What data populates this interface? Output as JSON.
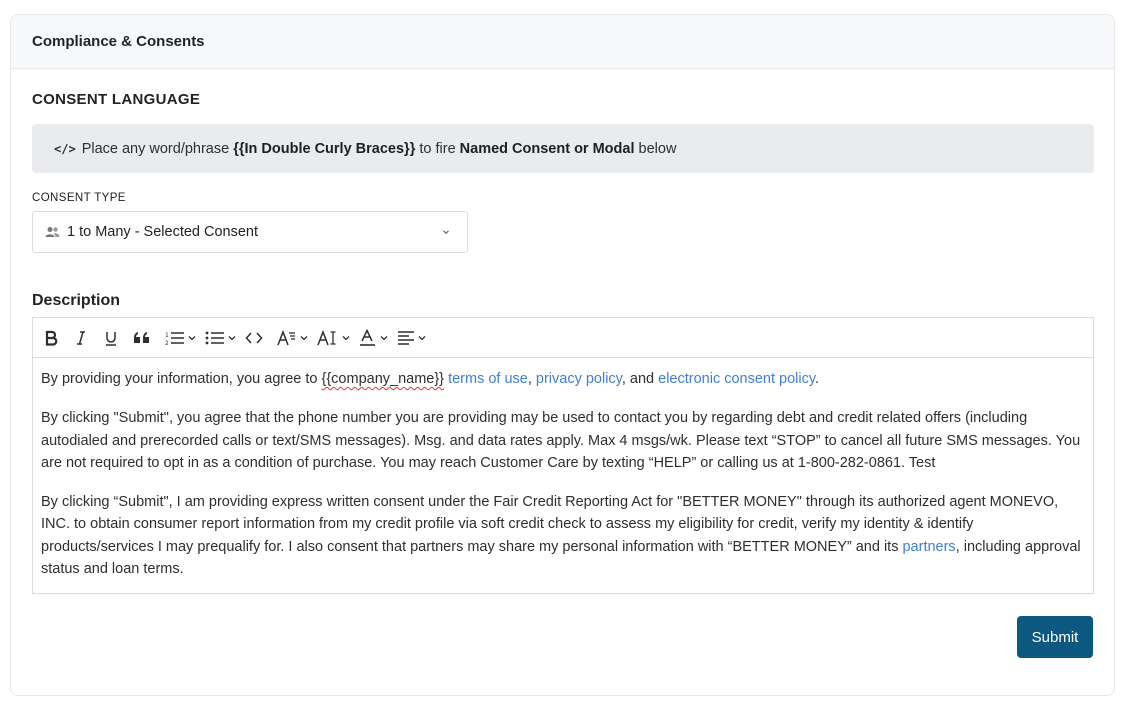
{
  "card": {
    "title": "Compliance & Consents"
  },
  "section": {
    "title": "CONSENT LANGUAGE"
  },
  "info": {
    "icon": "code-icon",
    "icon_glyph": "</>",
    "text_1": "Place any word/phrase ",
    "bold_1": "{{In Double Curly Braces}}",
    "text_2": " to fire ",
    "bold_2": "Named Consent or Modal",
    "text_3": " below"
  },
  "consent_type": {
    "label": "CONSENT TYPE",
    "icon": "users-icon",
    "selected": "1 to Many - Selected Consent"
  },
  "description": {
    "label": "Description",
    "toolbar": [
      "bold-icon",
      "italic-icon",
      "underline-icon",
      "blockquote-icon",
      "numbered-list-icon",
      "bulleted-list-icon",
      "code-icon",
      "text-style-icon",
      "font-size-icon",
      "font-color-icon",
      "align-icon"
    ],
    "p1": {
      "t1": "By providing your information, you agree to ",
      "t2": "{{company_name}}",
      "t3": " ",
      "link1": "terms of use",
      "t4": ", ",
      "link2": "privacy policy",
      "t5": ", and ",
      "link3": "electronic consent policy",
      "t6": "."
    },
    "p2": "By clicking \"Submit\", you agree that the phone number you are providing may be used to contact you by regarding debt and credit related offers (including autodialed and prerecorded calls or text/SMS messages). Msg. and data rates apply. Max 4 msgs/wk. Please text “STOP” to cancel all future SMS messages. You are not required to opt in as a condition of purchase. You may reach Customer Care by texting “HELP” or calling us at 1-800-282-0861. Test",
    "p3": {
      "t1": "By clicking “Submit\", I am providing express written consent under the Fair Credit Reporting Act for \"BETTER MONEY\" through its authorized agent MONEVO, INC. to obtain consumer report information from my credit profile via soft credit check to assess my eligibility for credit, verify my identity & identify products/services I may prequalify for. I also consent that partners may share my personal information with “BETTER MONEY” and its ",
      "link": "partners",
      "t2": ", including approval status and loan terms."
    }
  },
  "actions": {
    "submit_label": "Submit"
  },
  "colors": {
    "accent": "#0d5880",
    "link": "#3f7fd6",
    "info_bg": "#e9ebee"
  }
}
